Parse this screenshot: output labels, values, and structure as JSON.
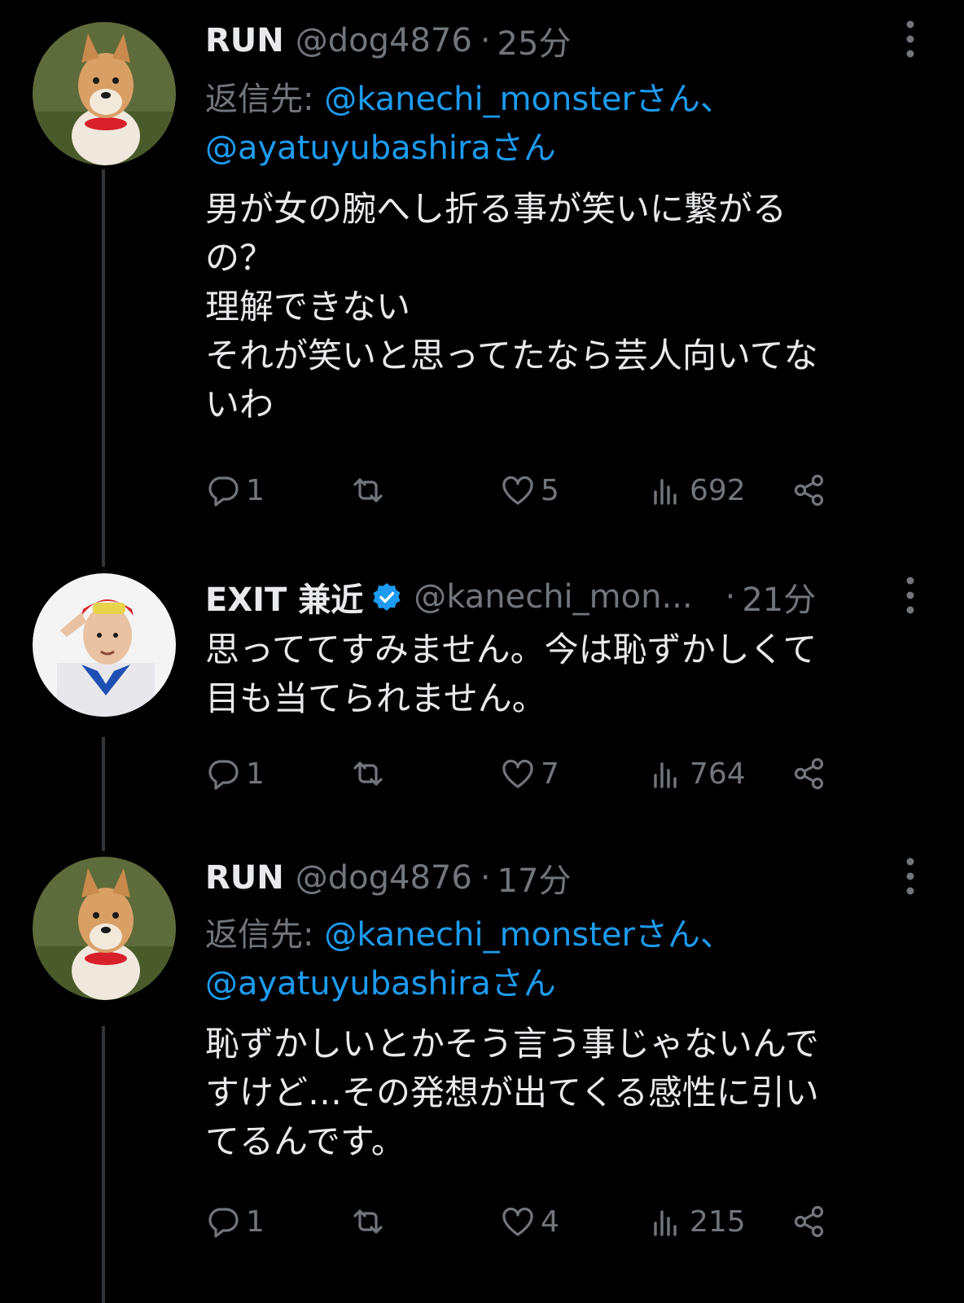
{
  "tweets": [
    {
      "name": "RUN",
      "handle": "@dog4876",
      "sep": "·",
      "time": "25分",
      "reply_prefix": "返信先: ",
      "mention1": "@kanechi_monsterさん",
      "reply_comma": "、",
      "mention2": "@ayatuyubashiraさん",
      "text": "男が女の腕へし折る事が笑いに繋がる\nの？\n理解できない\nそれが笑いと思ってたなら芸人向いてな\nいわ",
      "replies": "1",
      "likes": "5",
      "views": "692"
    },
    {
      "name": "EXIT 兼近",
      "handle": "@kanechi_mon...",
      "sep": "·",
      "time": "21分",
      "text": "思っててすみません。今は恥ずかしくて\n目も当てられません。",
      "replies": "1",
      "likes": "7",
      "views": "764"
    },
    {
      "name": "RUN",
      "handle": "@dog4876",
      "sep": "·",
      "time": "17分",
      "reply_prefix": "返信先: ",
      "mention1": "@kanechi_monsterさん",
      "reply_comma": "、",
      "mention2": "@ayatuyubashiraさん",
      "text": "恥ずかしいとかそう言う事じゃないんで\nすけど…その発想が出てくる感性に引い\nてるんです。",
      "replies": "1",
      "likes": "4",
      "views": "215"
    }
  ],
  "colors": {
    "background": "#000000",
    "text": "#e7e9ea",
    "muted": "#71767b",
    "link": "#1d9bf0",
    "verified": "#1d9bf0"
  },
  "icons": [
    "reply-icon",
    "retweet-icon",
    "like-icon",
    "views-icon",
    "share-icon",
    "more-icon",
    "verified-badge-icon"
  ]
}
